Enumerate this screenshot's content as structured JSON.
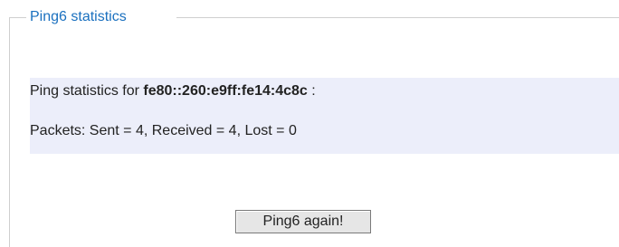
{
  "panel": {
    "legend": "Ping6 statistics"
  },
  "stats": {
    "line1_prefix": "Ping statistics for ",
    "address": "fe80::260:e9ff:fe14:4c8c",
    "line1_suffix": " :",
    "line2": "Packets: Sent = 4, Received = 4, Lost = 0"
  },
  "actions": {
    "again_label": "Ping6 again!"
  },
  "colors": {
    "legend": "#1a70bf",
    "stats_background": "#eceefa",
    "frame": "#cfcfcf"
  }
}
